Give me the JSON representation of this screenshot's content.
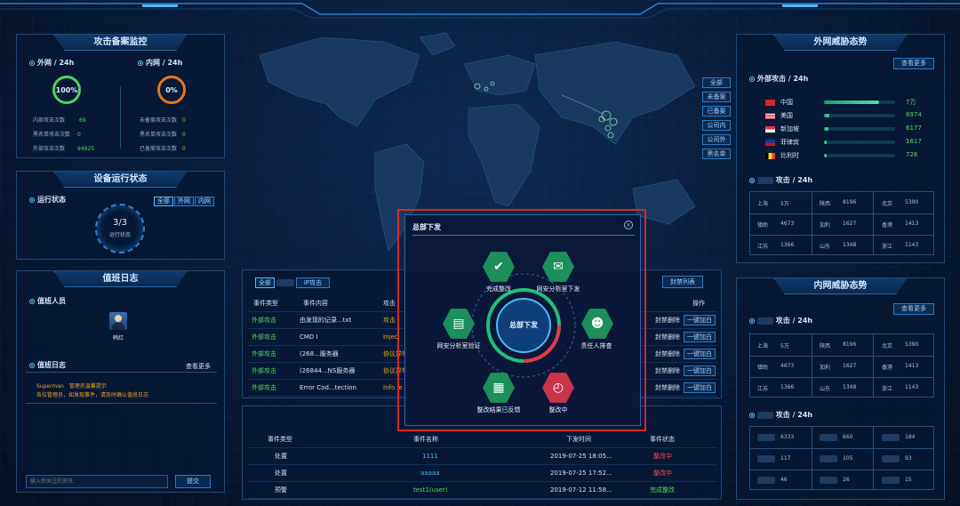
{
  "attack_monitor": {
    "title": "攻击备案监控",
    "ext": {
      "label": "外网 / 24h",
      "percent": "100%",
      "stats": [
        {
          "k": "内部攻击次数",
          "v": "69"
        },
        {
          "k": "黑名单攻击次数",
          "v": "0"
        },
        {
          "k": "外部攻击次数",
          "v": "94925"
        }
      ]
    },
    "int": {
      "label": "内网 / 24h",
      "percent": "0%",
      "stats": [
        {
          "k": "未备案攻击次数",
          "v": "0"
        },
        {
          "k": "黑名单攻击次数",
          "v": "0"
        },
        {
          "k": "已备案攻击次数",
          "v": "0"
        }
      ]
    }
  },
  "device_status": {
    "title": "设备运行状态",
    "label": "运行状态",
    "tabs": [
      "全部",
      "外网",
      "内网"
    ],
    "count": "3/3",
    "count_label": "运行状态"
  },
  "duty_log": {
    "title": "值班日志",
    "staff_label": "值班人员",
    "staff_name": "韩红",
    "log_label": "值班日志",
    "more": "查看更多",
    "entry_user": "Superman",
    "entry_tag": "管理员温馨提示",
    "entry_text": "各位管理员，如发现事件，请及时确认值班日志",
    "input_placeholder": "输入你关注的资讯",
    "submit": "提交"
  },
  "map_filters": [
    "全部",
    "未备案",
    "已备案",
    "公司内",
    "公司外",
    "黑名单"
  ],
  "event_panel": {
    "tabs": [
      "全部",
      "IP攻击"
    ],
    "block_btn": "封禁列表",
    "headers": [
      "事件类型",
      "事件内容",
      "攻击",
      "操作"
    ],
    "rows": [
      {
        "type": "外部攻击",
        "content": "由发现的记录...txt",
        "attack": "攻击",
        "action": "一键加白",
        "status": "封禁删除"
      },
      {
        "type": "外部攻击",
        "content": "CMD I",
        "attack": "Injec",
        "action": "一键加白",
        "status": "封禁删除"
      },
      {
        "type": "外部攻击",
        "content": "(268...服务器",
        "attack": "协议异常",
        "action": "一键加白",
        "status": "封禁删除"
      },
      {
        "type": "外部攻击",
        "content": "(26844...NS服务器",
        "attack": "协议异常",
        "action": "一键加白",
        "status": "封禁删除"
      },
      {
        "type": "外部攻击",
        "content": "Error Cod...tection",
        "attack": "Info le",
        "action": "一键加白",
        "status": "封禁删除"
      }
    ]
  },
  "issue_table": {
    "headers": [
      "事件类型",
      "事件名称",
      "下发时间",
      "事件状态"
    ],
    "rows": [
      {
        "type": "处置",
        "name": "1111",
        "time": "2019-07-25 18:05...",
        "status": "整改中"
      },
      {
        "type": "处置",
        "name": "aaaaa",
        "time": "2019-07-25 17:52...",
        "status": "整改中"
      },
      {
        "type": "预警",
        "name": "test1(user)",
        "time": "2019-07-12 11:58...",
        "status": "完成整改"
      }
    ]
  },
  "modal": {
    "title": "总部下发",
    "center": "总部下发",
    "nodes": [
      {
        "label": "完成整改",
        "icon": "check-icon"
      },
      {
        "label": "网安分析室下发",
        "icon": "send-icon"
      },
      {
        "label": "网安分析室验证",
        "icon": "book-icon"
      },
      {
        "label": "责任人排查",
        "icon": "person-icon"
      },
      {
        "label": "整改结果已反馈",
        "icon": "doc-icon"
      },
      {
        "label": "整改中",
        "icon": "doc-clock-icon"
      }
    ]
  },
  "ext_threat": {
    "title": "外网威胁态势",
    "more": "查看更多",
    "label": "外部攻击 / 24h",
    "countries": [
      {
        "name": "中国",
        "value": "7万",
        "fill": 0.78
      },
      {
        "name": "美国",
        "value": "6974",
        "fill": 0.07
      },
      {
        "name": "新加坡",
        "value": "6177",
        "fill": 0.06
      },
      {
        "name": "菲律宾",
        "value": "1617",
        "fill": 0.02
      },
      {
        "name": "比利时",
        "value": "726",
        "fill": 0.01
      }
    ],
    "sub_label": "攻击 / 24h",
    "grid": [
      [
        "上海",
        "5万",
        "陕西",
        "8196",
        "北京",
        "5390"
      ],
      [
        "镇助",
        "4673",
        "加利",
        "1627",
        "香港",
        "1413"
      ],
      [
        "江苏",
        "1366",
        "山东",
        "1348",
        "浙江",
        "1143"
      ]
    ]
  },
  "int_threat": {
    "title": "内网威胁态势",
    "more": "查看更多",
    "label": "攻击 / 24h",
    "grid": [
      [
        "上海",
        "5万",
        "陕西",
        "8196",
        "北京",
        "5390"
      ],
      [
        "镇助",
        "4673",
        "加利",
        "1627",
        "香港",
        "1413"
      ],
      [
        "江苏",
        "1366",
        "山东",
        "1348",
        "浙江",
        "1143"
      ]
    ],
    "label2": "攻击 / 24h",
    "grid2": [
      [
        "6333",
        "660",
        "184"
      ],
      [
        "117",
        "105",
        "93"
      ],
      [
        "46",
        "26",
        "15"
      ]
    ]
  }
}
